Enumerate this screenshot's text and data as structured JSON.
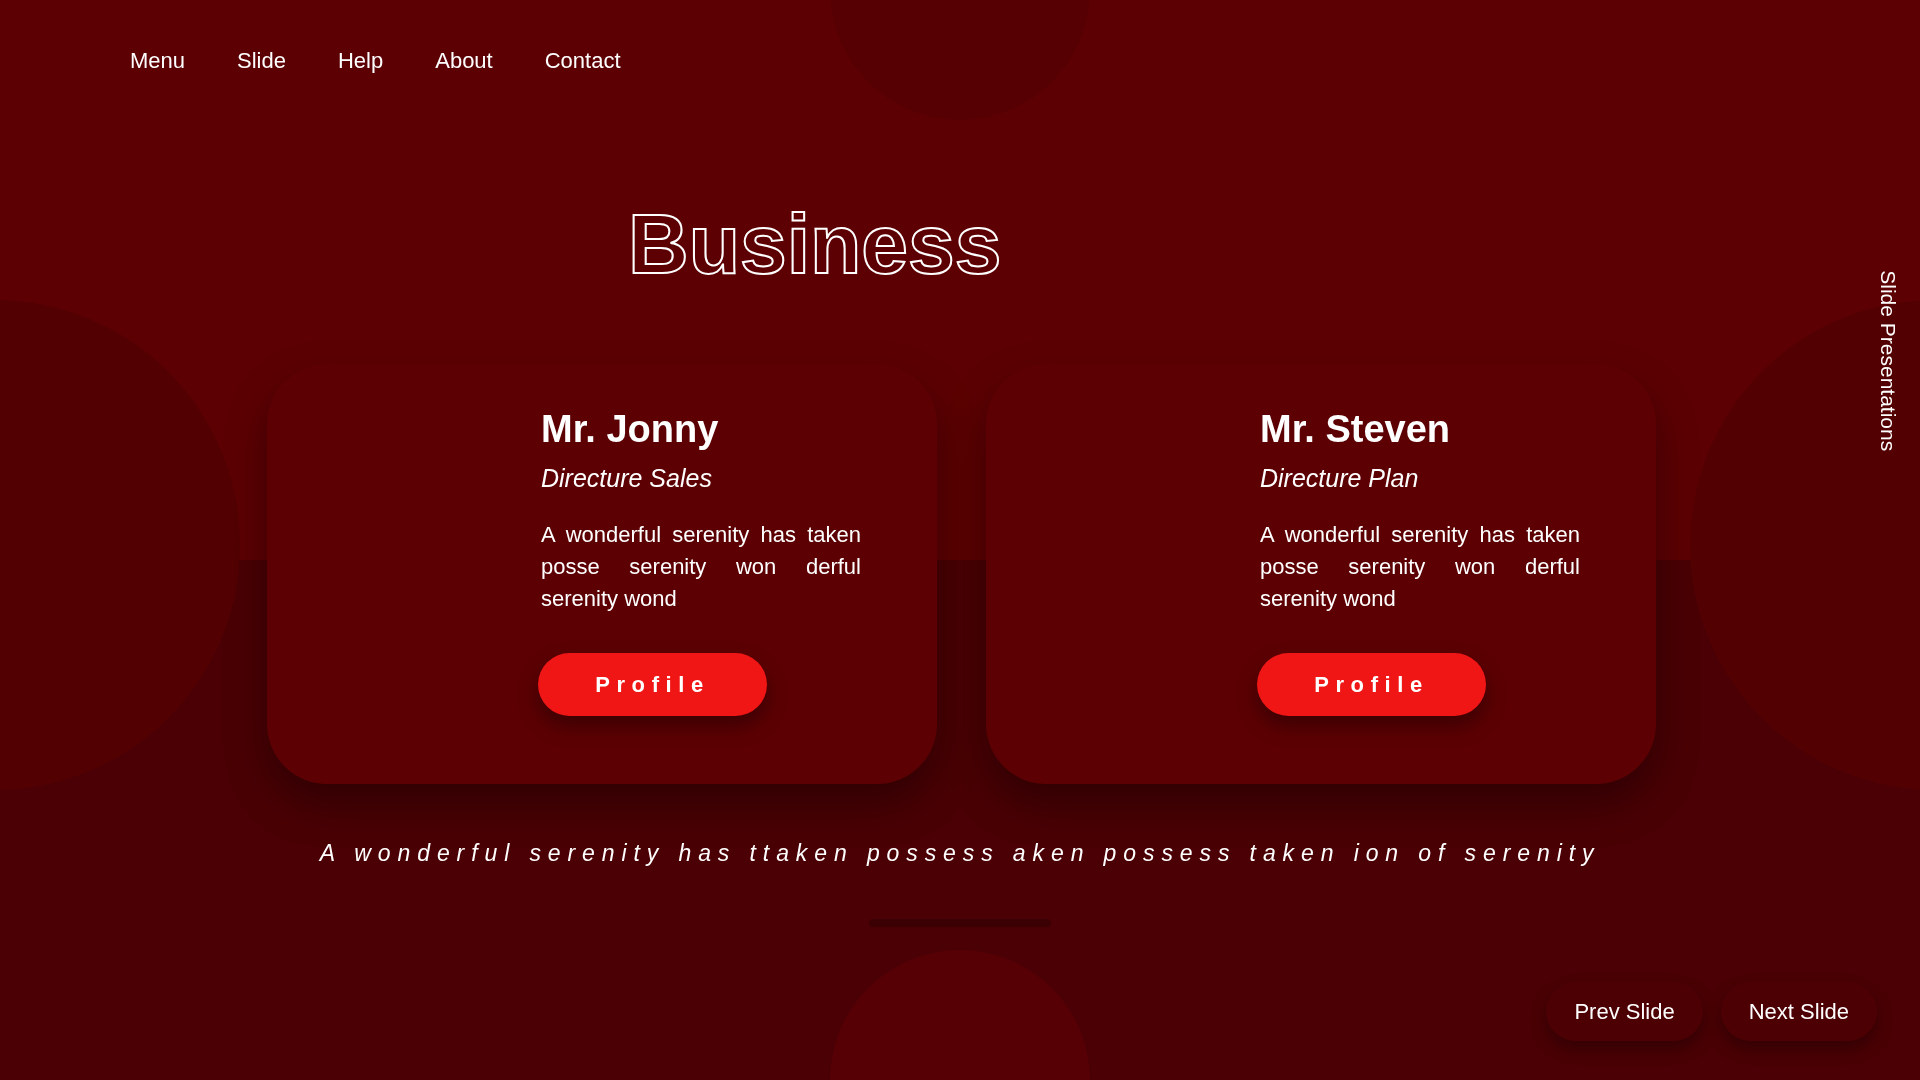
{
  "nav": [
    "Menu",
    "Slide",
    "Help",
    "About",
    "Contact"
  ],
  "title": "Business",
  "side_label": "Slide Presentations",
  "cards": [
    {
      "name": "Mr. Jonny",
      "role": "Directure Sales",
      "text": "A wonderful serenity has taken posse serenity won derful serenity wond",
      "button": "Profile"
    },
    {
      "name": "Mr. Steven",
      "role": "Directure Plan",
      "text": "A wonderful serenity has taken posse serenity won derful serenity wond",
      "button": "Profile"
    }
  ],
  "tagline": "A wonderful serenity has ttaken possess aken possess taken ion of serenity",
  "buttons": [
    "Prev Slide",
    "Next Slide"
  ]
}
